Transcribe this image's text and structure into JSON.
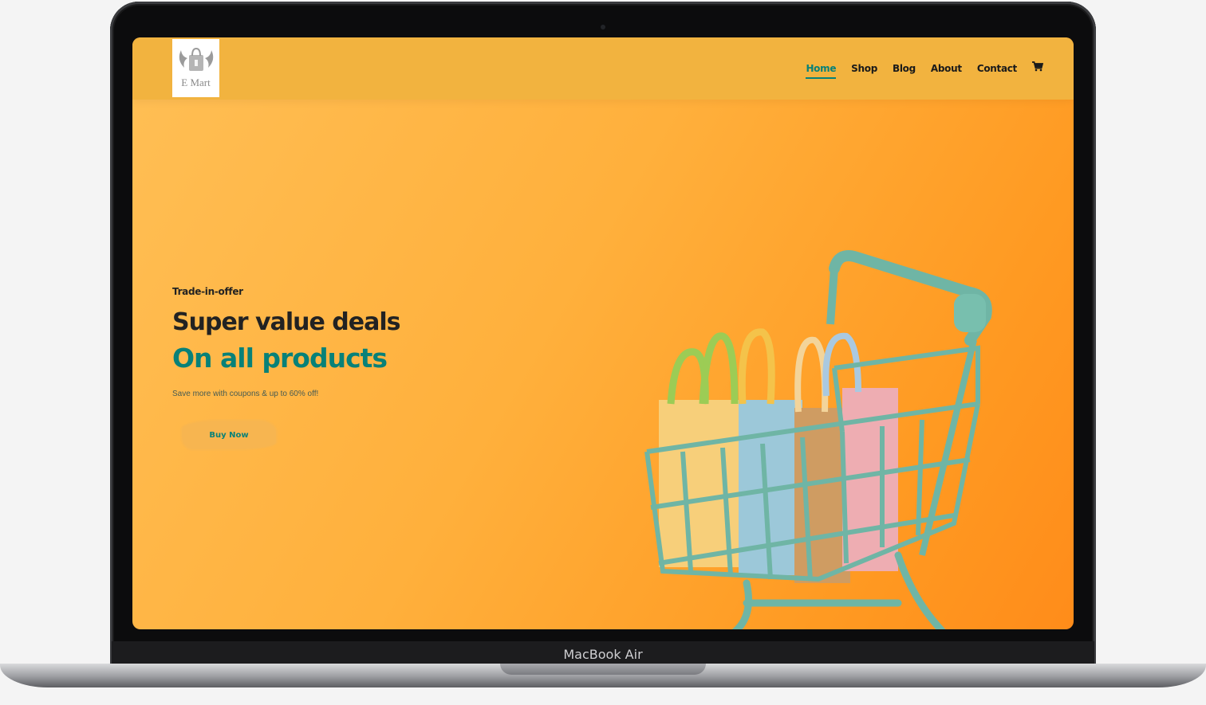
{
  "device": {
    "label": "MacBook Air"
  },
  "brand": {
    "logo_text": "E Mart",
    "logo_icon": "winged-bag-icon"
  },
  "nav": {
    "items": [
      {
        "label": "Home",
        "active": true
      },
      {
        "label": "Shop",
        "active": false
      },
      {
        "label": "Blog",
        "active": false
      },
      {
        "label": "About",
        "active": false
      },
      {
        "label": "Contact",
        "active": false
      }
    ],
    "cart_icon": "cart-icon"
  },
  "hero": {
    "eyebrow": "Trade-in-offer",
    "title": "Super value deals",
    "highlight": "On all products",
    "subtitle": "Save more with coupons & up to 60% off!",
    "cta_label": "Buy Now"
  },
  "colors": {
    "accent": "#088178",
    "navbar": "#f2b33f",
    "hero_bg": "#ffb03c",
    "button_bg": "#f7b550"
  }
}
